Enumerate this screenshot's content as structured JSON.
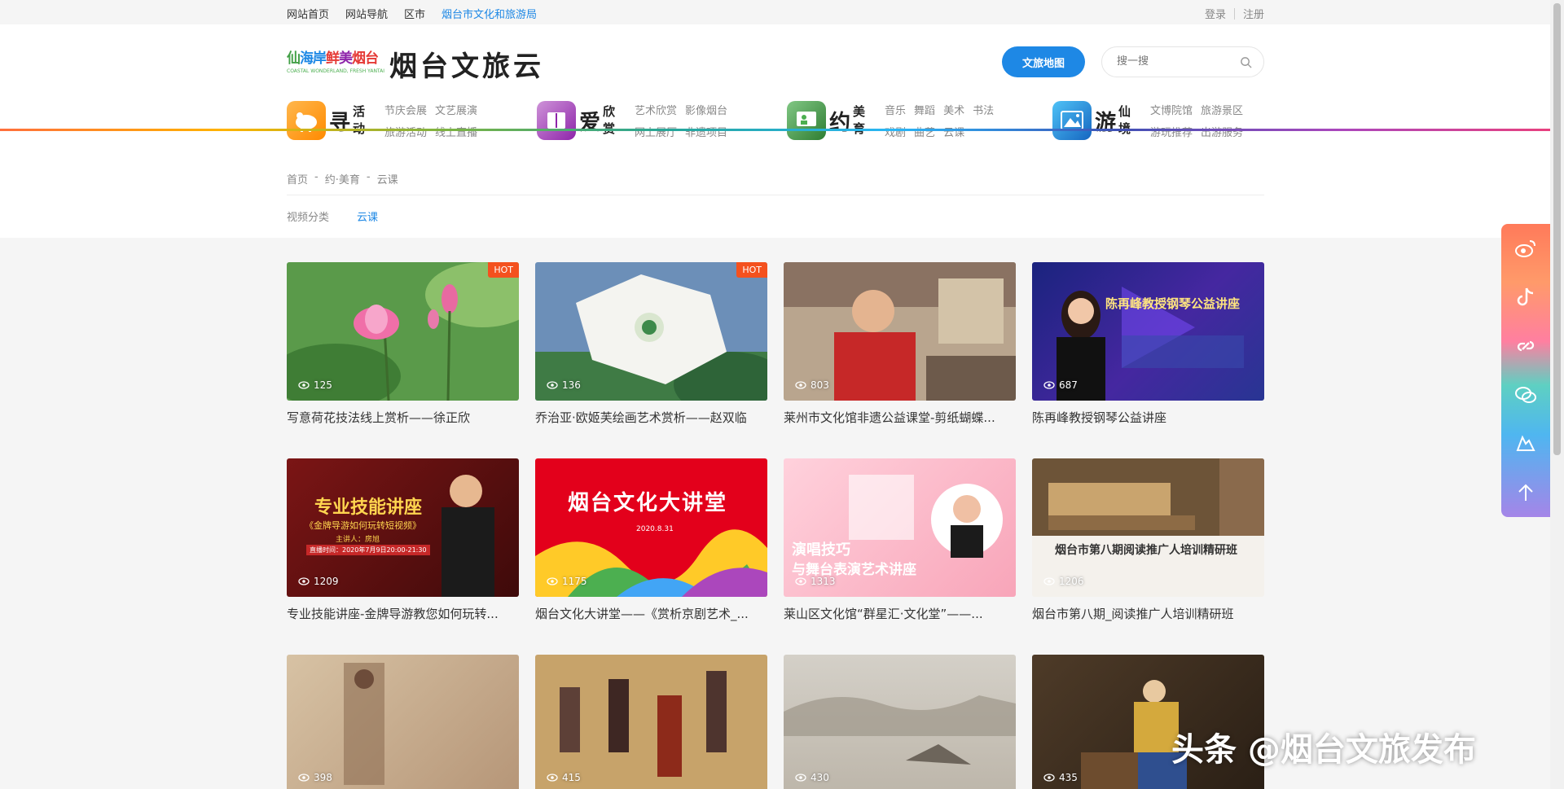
{
  "topbar": {
    "links": [
      "网站首页",
      "网站导航",
      "区市",
      "烟台市文化和旅游局"
    ],
    "login": "登录",
    "register": "注册"
  },
  "logo": {
    "badge_line1": [
      "仙",
      "海",
      "岸",
      "鲜",
      "美",
      "烟",
      "台"
    ],
    "badge_tagline": "COASTAL WONDERLAND, FRESH YANTAI",
    "site_name": "烟台文旅云"
  },
  "header": {
    "map_button": "文旅地图",
    "search_placeholder": "搜一搜"
  },
  "nav": [
    {
      "big": "寻",
      "small": [
        "活",
        "动"
      ],
      "items": [
        "节庆会展",
        "文艺展演",
        "旅游活动",
        "线上直播"
      ],
      "color": "#ff9800"
    },
    {
      "big": "爱",
      "small": [
        "欣",
        "赏"
      ],
      "items": [
        "艺术欣赏",
        "影像烟台",
        "网上展厅",
        "非遗项目"
      ],
      "color": "#ab47bc"
    },
    {
      "big": "约",
      "small": [
        "美",
        "育"
      ],
      "items": [
        "音乐",
        "舞蹈",
        "美术",
        "书法",
        "戏剧",
        "曲艺",
        "云课"
      ],
      "color": "#4caf50"
    },
    {
      "big": "游",
      "small": [
        "仙",
        "境"
      ],
      "items": [
        "文博院馆",
        "旅游景区",
        "游玩推荐",
        "出游服务"
      ],
      "color": "#1e88e5"
    }
  ],
  "breadcrumb": [
    "首页",
    "-",
    "约·美育",
    "-",
    "云课"
  ],
  "filters": {
    "label": "视频分类",
    "value": "云课"
  },
  "cards": [
    {
      "title": "写意荷花技法线上赏析——徐正欣",
      "views": "125",
      "hot": "HOT"
    },
    {
      "title": "乔治亚·欧姬芙绘画艺术赏析——赵双临",
      "views": "136",
      "hot": "HOT"
    },
    {
      "title": "莱州市文化馆非遗公益课堂-剪纸蝴蝶...",
      "views": "803",
      "hot": ""
    },
    {
      "title": "陈再峰教授钢琴公益讲座",
      "views": "687",
      "hot": ""
    },
    {
      "title": "专业技能讲座-金牌导游教您如何玩转...",
      "views": "1209",
      "hot": ""
    },
    {
      "title": "烟台文化大讲堂——《赏析京剧艺术_...",
      "views": "1175",
      "hot": ""
    },
    {
      "title": "莱山区文化馆“群星汇·文化堂”——...",
      "views": "1313",
      "hot": ""
    },
    {
      "title": "烟台市第八期_阅读推广人培训精研班",
      "views": "1206",
      "hot": ""
    },
    {
      "title": "",
      "views": "398",
      "hot": ""
    },
    {
      "title": "",
      "views": "415",
      "hot": ""
    },
    {
      "title": "",
      "views": "430",
      "hot": ""
    },
    {
      "title": "",
      "views": "435",
      "hot": ""
    }
  ],
  "thumb_text": {
    "c4": "陈再峰教授钢琴公益讲座",
    "c5_title": "专业技能讲座",
    "c5_sub": "《金牌导游如何玩转短视频》",
    "c5_speaker": "主讲人：房旭",
    "c5_time": "直播时间：2020年7月9日20:00-21:30",
    "c6_title": "烟台文化大讲堂",
    "c6_date": "2020.8.31",
    "c7_title": "演唱技巧",
    "c7_title2": "与舞台表演艺术讲座",
    "c8_title": "烟台市第八期阅读推广人培训精研班"
  },
  "watermark": "头条 @烟台文旅发布"
}
